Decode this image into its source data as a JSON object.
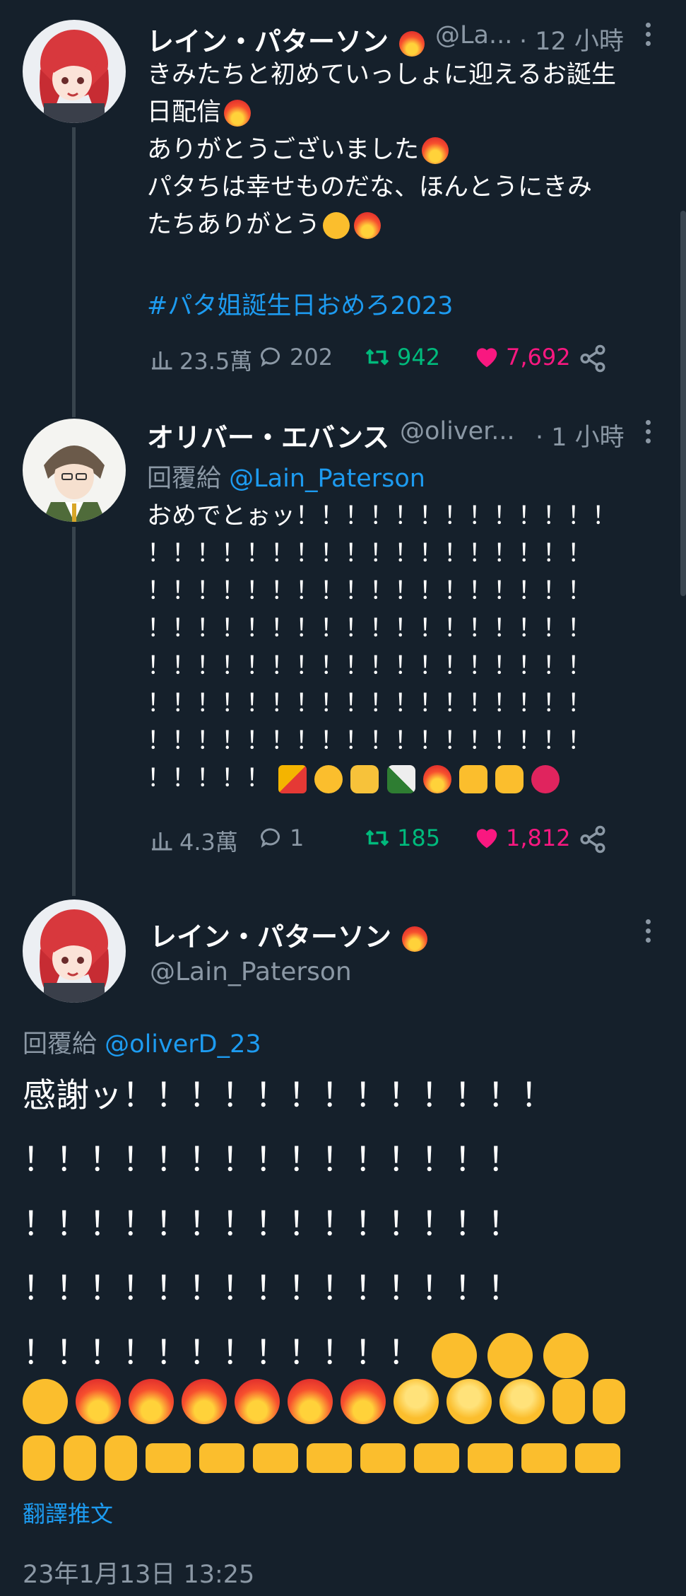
{
  "colors": {
    "background": "#15202b",
    "accent": "#1d9bf0",
    "like": "#f91880",
    "retweet": "#00ba7c",
    "muted": "#8b98a5"
  },
  "tweet1": {
    "name": "レイン・パターソン",
    "handle": "@La...",
    "time": "· 12 小時",
    "lines": [
      "きみたちと初めていっしょに迎えるお誕生",
      "日配信",
      "ありがとうございました",
      "パタちは幸せものだな、ほんとうにきみ",
      "たちありがとう"
    ],
    "hashtag": "#パタ姐誕生日おめろ2023",
    "views": "23.5萬",
    "replies": "202",
    "retweets": "942",
    "likes": "7,692"
  },
  "tweet2": {
    "name": "オリバー・エバンス",
    "handle": "@oliver...",
    "time": "· 1 小時",
    "reply_prefix": "回覆給",
    "reply_to": "@Lain_Paterson",
    "lines": [
      "おめでとぉッ！！！！！！！！！！！！！",
      "！！！！！！！！！！！！！！！！！！",
      "！！！！！！！！！！！！！！！！！！",
      "！！！！！！！！！！！！！！！！！！",
      "！！！！！！！！！！！！！！！！！！",
      "！！！！！！！！！！！！！！！！！！",
      "！！！！！！！！！！！！！！！！！！",
      "！！！！！"
    ],
    "views": "4.3萬",
    "replies": "1",
    "retweets": "185",
    "likes": "1,812"
  },
  "tweet3": {
    "name": "レイン・パターソン",
    "handle": "@Lain_Paterson",
    "reply_prefix": "回覆給",
    "reply_to": "@oliverD_23",
    "lines": [
      "感謝ッ！！！！！！！！！！！！！",
      "！！！！！！！！！！！！！！！",
      "！！！！！！！！！！！！！！！",
      "！！！！！！！！！！！！！！！",
      "！！！！！！！！！！！！"
    ],
    "translate": "翻譯推文",
    "timestamp": "23年1月13日 13:25"
  }
}
